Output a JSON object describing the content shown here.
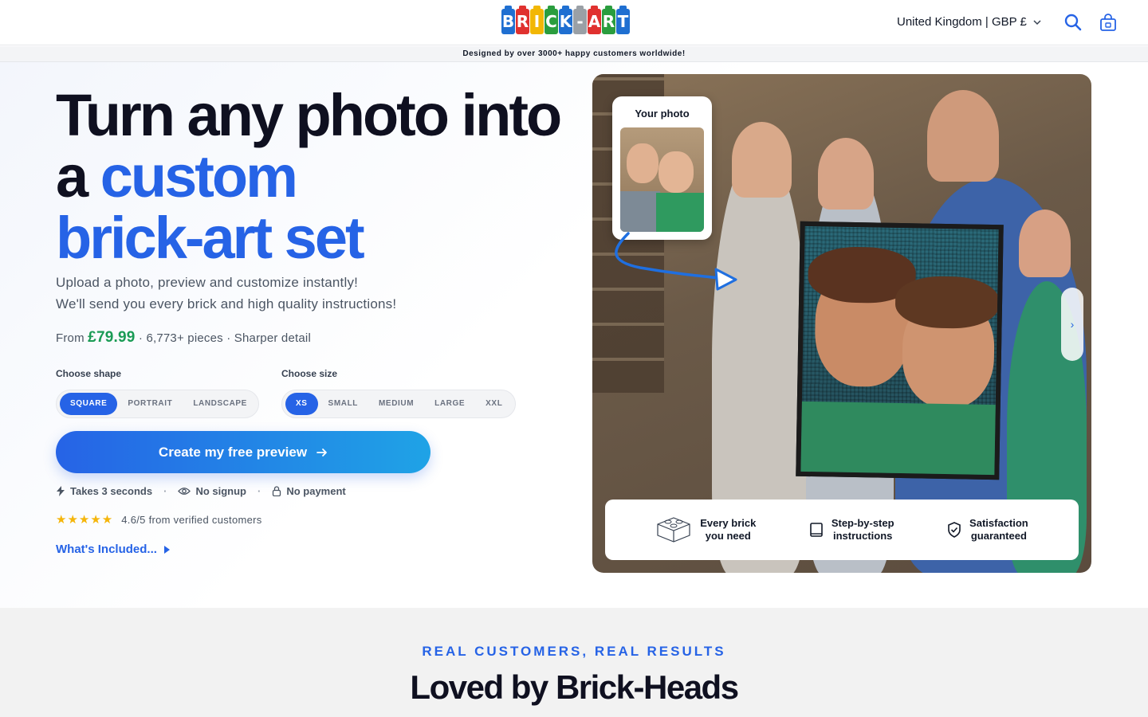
{
  "header": {
    "logo_letters": [
      "B",
      "R",
      "I",
      "C",
      "K",
      "-",
      "A",
      "R",
      "T"
    ],
    "logo_colors": [
      "#1f6fd1",
      "#e0312f",
      "#f2b705",
      "#2a9d3e",
      "#1f6fd1",
      "#9aa0a6",
      "#e0312f",
      "#2a9d3e",
      "#1f6fd1"
    ],
    "region_label": "United Kingdom | GBP £"
  },
  "announcement": "Designed by over 3000+ happy customers worldwide!",
  "hero": {
    "title_line1": "Turn any photo into",
    "title_a": "a",
    "title_custom": "custom",
    "title_line3": "brick-art set",
    "sub_line1": "Upload a photo, preview and customize instantly!",
    "sub_line2": "We'll send you every brick and high quality instructions!",
    "price_from": "From",
    "price_amount": "£79.99",
    "price_details": "· 6,773+ pieces · Sharper detail",
    "shape_label": "Choose shape",
    "shape_options": [
      "SQUARE",
      "PORTRAIT",
      "LANDSCAPE"
    ],
    "size_label": "Choose size",
    "size_options": [
      "XS",
      "SMALL",
      "MEDIUM",
      "LARGE",
      "XXL"
    ],
    "cta_label": "Create my free preview",
    "perk_1": "Takes 3 seconds",
    "perk_2": "No signup",
    "perk_3": "No payment",
    "rating_stars": "★★★★★",
    "rating_text": "4.6/5 from verified customers",
    "included_label": "What's Included..."
  },
  "image_panel": {
    "your_photo_label": "Your photo",
    "next_label": "›",
    "feature_1": "Every brick you need",
    "feature_1a": "Every brick",
    "feature_1b": "you need",
    "feature_2a": "Step-by-step",
    "feature_2b": "instructions",
    "feature_3a": "Satisfaction",
    "feature_3b": "guaranteed"
  },
  "reviews": {
    "eyebrow": "REAL CUSTOMERS, REAL RESULTS",
    "title": "Loved by Brick-Heads"
  },
  "colors": {
    "accent": "#2663e6",
    "price_green": "#1a9b55",
    "star": "#f5b50a"
  }
}
